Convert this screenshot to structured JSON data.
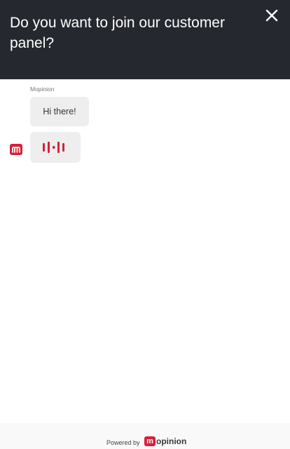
{
  "header": {
    "title": "Do you want to join our customer panel?"
  },
  "chat": {
    "sender_name": "Mopinion",
    "messages": [
      {
        "text": "Hi there!"
      }
    ],
    "typing_indicator": true
  },
  "footer": {
    "powered_by": "Powered by",
    "brand_initial": "m",
    "brand_name": "opinion"
  },
  "colors": {
    "header_bg": "#262830",
    "brand_red": "#d4223a",
    "bubble_bg": "#eeeeee"
  },
  "icons": {
    "close": "close-icon",
    "avatar": "mopinion-logo-icon",
    "typing": "typing-dots-icon"
  }
}
